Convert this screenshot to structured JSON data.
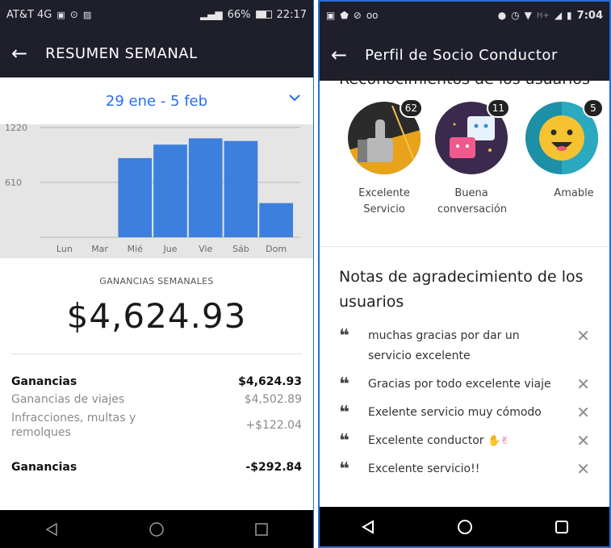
{
  "left": {
    "status": {
      "carrier": "AT&T 4G",
      "right": "66%",
      "time": "22:17"
    },
    "title": "RESUMEN SEMANAL",
    "date_range": "29 ene - 5 feb",
    "chart_data": {
      "type": "bar",
      "categories": [
        "Lun",
        "Mar",
        "Mié",
        "Jue",
        "Vie",
        "Sáb",
        "Dom"
      ],
      "values": [
        0,
        0,
        880,
        1030,
        1100,
        1070,
        380
      ],
      "ylim": [
        0,
        1220
      ],
      "yticks": [
        "1220",
        "610"
      ],
      "grid": true,
      "bar_color": "#3d7fdc"
    },
    "summary_label": "GANANCIAS SEMANALES",
    "summary_value": "$4,624.93",
    "earnings": [
      {
        "label": "Ganancias",
        "value": "$4,624.93"
      },
      {
        "label": "Ganancias de viajes",
        "value": "$4,502.89"
      },
      {
        "label": "Infracciones, multas y remolques",
        "value": "+$122.04"
      },
      {
        "label": "Ganancias",
        "value": "-$292.84"
      }
    ]
  },
  "right": {
    "status": {
      "time": "7:04",
      "network": "H+"
    },
    "title": "Perfil de Socio Conductor",
    "partial_heading": "Reconocimientos de los usuarios",
    "badges": [
      {
        "label": "Excelente Servicio",
        "count": "62",
        "icon": "thumbs-up-icon"
      },
      {
        "label": "Buena conversación",
        "count": "11",
        "icon": "chat-bubbles-icon"
      },
      {
        "label": "Amable",
        "count": "5",
        "icon": "smile-icon"
      }
    ],
    "notes_heading": "Notas de agradecimiento de los usuarios",
    "notes": [
      {
        "text": "muchas gracias por dar un servicio  excelente"
      },
      {
        "text": "Gracias por todo excelente viaje"
      },
      {
        "text": "Exelente servicio muy cómodo"
      },
      {
        "text": "Excelente conductor"
      },
      {
        "text": "Excelente servicio!!"
      }
    ]
  },
  "colors": {
    "accent": "#276ef1",
    "bar": "#3d7fdc",
    "header": "#1e1f2b"
  }
}
